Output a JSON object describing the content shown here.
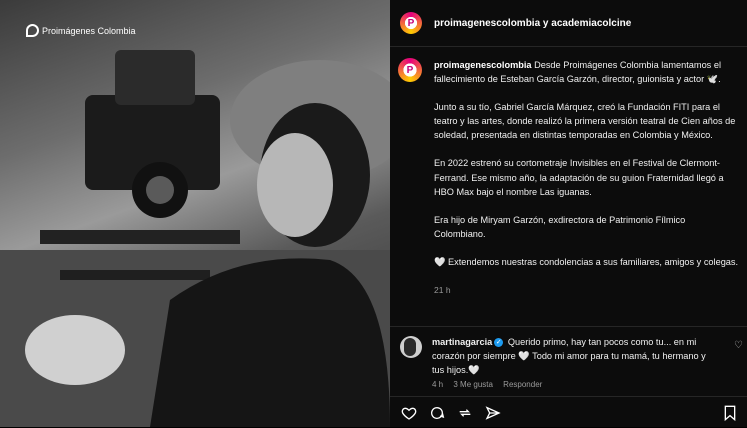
{
  "photo": {
    "logo_text": "Proimágenes Colombia"
  },
  "post": {
    "header_title": "proimagenescolombia y academiacolcine",
    "avatar_letter": "P",
    "username": "proimagenescolombia",
    "paragraphs": [
      "Desde Proimágenes Colombia lamentamos el fallecimiento de Esteban García Garzón, director, guionista y actor 🕊️.",
      "Junto a su tío, Gabriel García Márquez, creó la Fundación FITI para el teatro y las artes, donde realizó la primera versión teatral de Cien años de soledad, presentada en distintas temporadas en Colombia y México.",
      "En 2022 estrenó su cortometraje Invisibles en el Festival de Clermont-Ferrand. Ese mismo año, la adaptación de su guion Fraternidad llegó a HBO Max bajo el nombre Las iguanas.",
      "Era hijo de Miryam Garzón, exdirectora de Patrimonio Fílmico Colombiano.",
      "🤍  Extendemos nuestras condolencias a sus familiares, amigos y colegas."
    ],
    "time": "21 h"
  },
  "comment": {
    "username": "martinagarcia",
    "text": "Querido primo, hay tan pocos como tu... en mi corazón por siempre 🤍 Todo mi amor para tu mamá, tu hermano y tus hijos.🤍",
    "time": "4 h",
    "likes": "3 Me gusta",
    "reply": "Responder"
  },
  "icons": [
    "heart-icon",
    "comment-icon",
    "repost-icon",
    "share-icon",
    "bookmark-icon"
  ]
}
